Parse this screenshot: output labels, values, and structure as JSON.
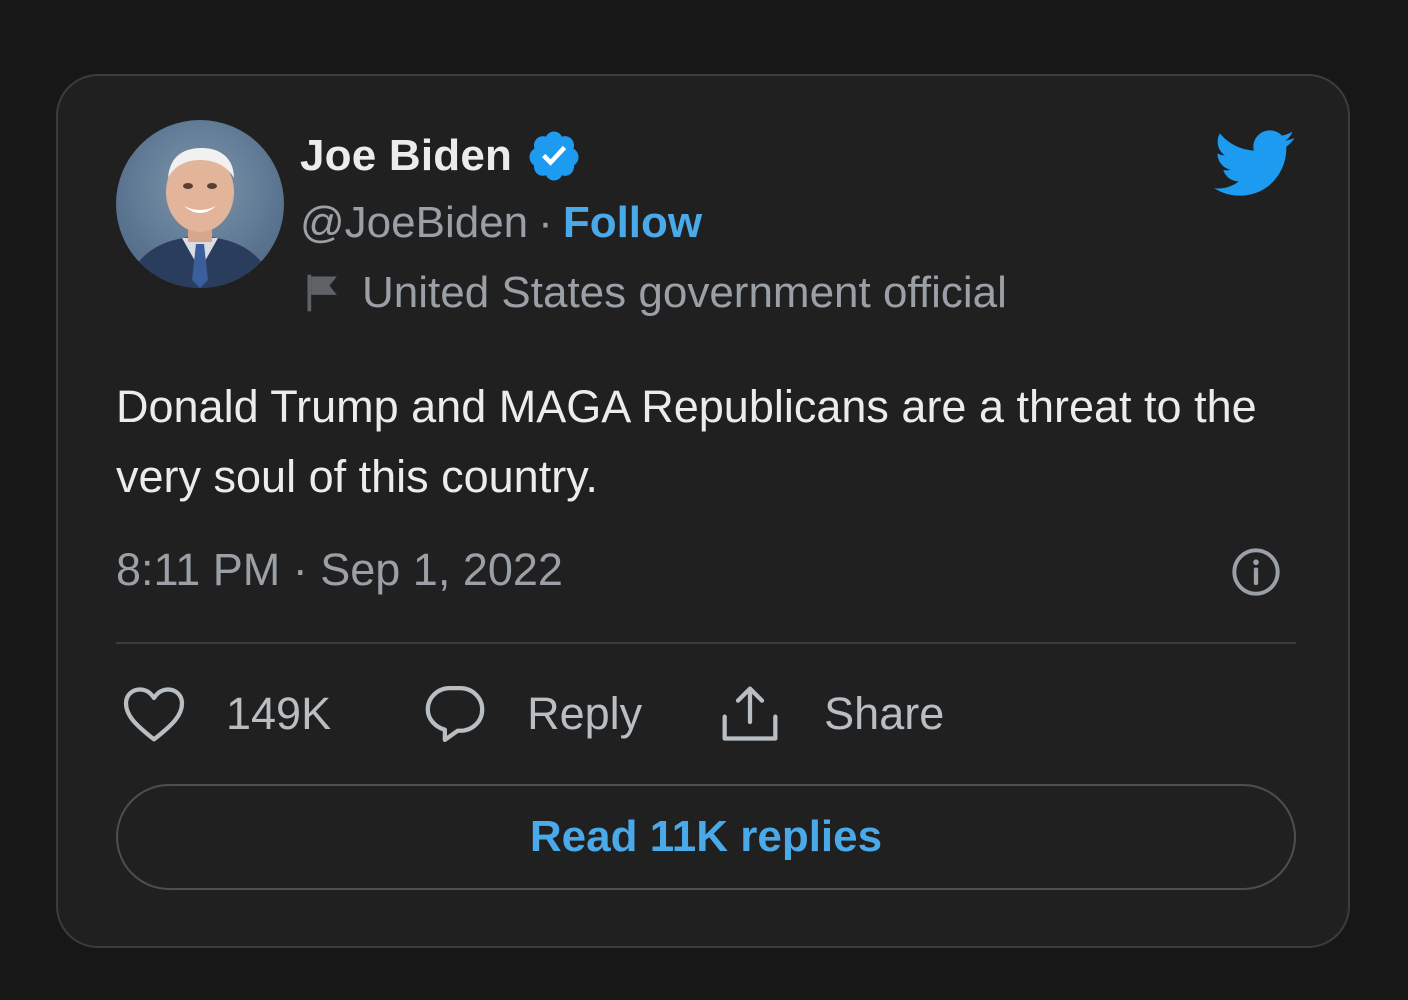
{
  "author": {
    "name": "Joe Biden",
    "handle": "@JoeBiden",
    "separator": "·",
    "follow_label": "Follow",
    "label": "United States government official",
    "avatar_icon": "profile-photo",
    "verified_icon": "verified-badge-icon",
    "label_icon": "flag-icon"
  },
  "brand": {
    "icon": "twitter-bird-icon",
    "color": "#1d9bf0"
  },
  "tweet": {
    "text": "Donald Trump and MAGA Republicans are a threat to the very soul of this country.",
    "timestamp": "8:11 PM · Sep 1, 2022"
  },
  "actions": {
    "likes": "149K",
    "reply_label": "Reply",
    "share_label": "Share"
  },
  "read_replies_label": "Read 11K replies",
  "colors": {
    "background": "#171717",
    "card": "#202020",
    "accent": "#4aa9e8",
    "text_primary": "#ececec",
    "text_secondary": "#9aa0a6"
  }
}
